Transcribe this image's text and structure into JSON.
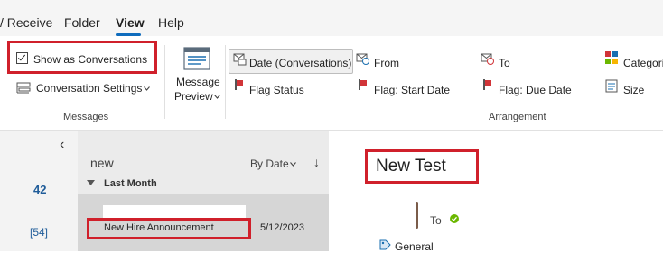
{
  "menubar": {
    "items": [
      "/ Receive",
      "Folder",
      "View",
      "Help"
    ],
    "active": "View"
  },
  "ribbon": {
    "messages_group": {
      "show_as_conversations": "Show as Conversations",
      "conversation_settings": "Conversation Settings",
      "label": "Messages"
    },
    "message_preview": {
      "line1": "Message",
      "line2": "Preview"
    },
    "arrangement": {
      "label": "Arrangement",
      "date_conversations": "Date (Conversations)",
      "from": "From",
      "to": "To",
      "categories": "Categori",
      "flag_status": "Flag Status",
      "flag_start_date": "Flag: Start Date",
      "flag_due_date": "Flag: Due Date",
      "size": "Size"
    }
  },
  "leftnav": {
    "count_1": "42",
    "count_2": "[54]",
    "collapse_glyph": "‹"
  },
  "message_list": {
    "search_text": "new",
    "sort_label": "By Date",
    "sort_arrow": "↓",
    "group_header": "Last Month",
    "item": {
      "subject": "New Hire Announcement",
      "date": "5/12/2023"
    }
  },
  "reading_pane": {
    "subject": "New Test",
    "to_label": "To",
    "category": "General"
  },
  "colors": {
    "accent": "#0f6cbd",
    "highlight_red": "#d0202b",
    "presence_green": "#6bb700"
  }
}
